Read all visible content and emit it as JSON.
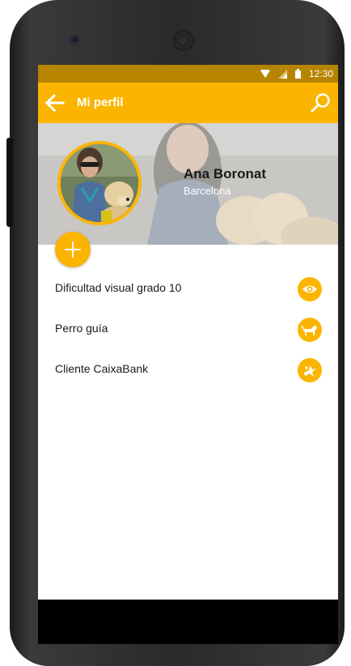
{
  "status_bar": {
    "time": "12:30"
  },
  "app_bar": {
    "title": "Mi perfil"
  },
  "profile": {
    "name": "Ana Boronat",
    "city": "Barcelona"
  },
  "items": [
    {
      "label": "Dificultad visual grado 10",
      "icon": "eye-icon"
    },
    {
      "label": "Perro guía",
      "icon": "dog-icon"
    },
    {
      "label": "Cliente CaixaBank",
      "icon": "caixabank-star-icon"
    }
  ],
  "colors": {
    "accent": "#fbb500",
    "status_bar": "#b78400",
    "text": "#1a1a1a"
  }
}
